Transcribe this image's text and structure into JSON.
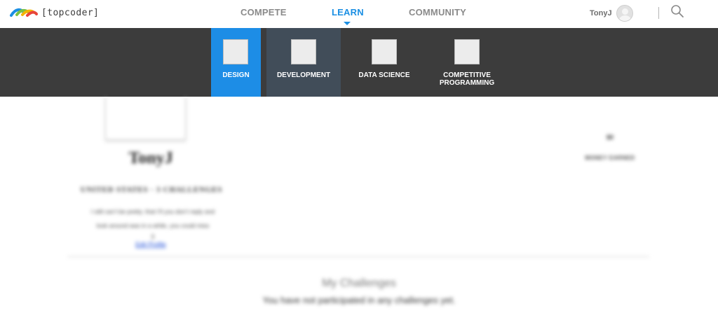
{
  "brand": {
    "logo_text": "[topcoder]",
    "logo_icon": "topcoder-rainbow-logo-icon"
  },
  "nav": {
    "compete": "COMPETE",
    "learn": "LEARN",
    "community": "COMMUNITY",
    "active": "LEARN",
    "accent_color": "#1b8fe3"
  },
  "user": {
    "name": "TonyJ",
    "avatar_icon": "user-avatar-icon"
  },
  "search": {
    "icon": "search-icon"
  },
  "submenu": {
    "items": [
      {
        "label": "DESIGN",
        "active": true,
        "color": "#1d8de6"
      },
      {
        "label": "DEVELOPMENT",
        "hover": true,
        "color": "#414d59"
      },
      {
        "label": "DATA SCIENCE"
      },
      {
        "label": "COMPETITIVE PROGRAMMING"
      }
    ],
    "background": "#3c3c3c"
  },
  "profile": {
    "handle": "TonyJ",
    "country_line": "UNITED STATES · 3 CHALLENGES",
    "bio_line1": "I still can’t be pretty; that I’ll you don’t reply and",
    "bio_line2": "look around was in a while, you could miss",
    "bio_separator": "||",
    "edit_link": "Edit Profile",
    "earnings_value": "$0",
    "earnings_label": "MONEY EARNED",
    "blurred": true
  },
  "challenges": {
    "heading": "My Challenges",
    "empty_message": "You have not participated in any challenges yet."
  }
}
